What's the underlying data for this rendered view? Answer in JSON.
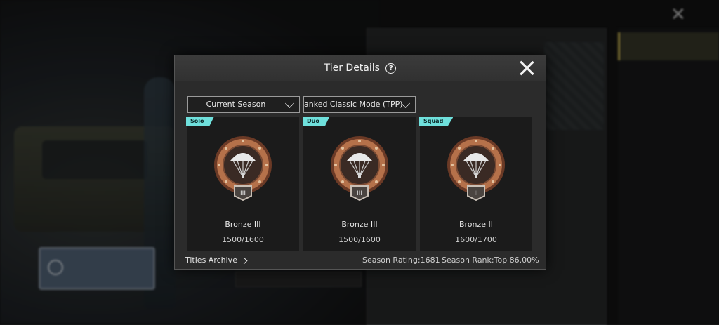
{
  "modal": {
    "title": "Tier Details",
    "help_icon": "question-circle-icon",
    "close_icon": "close-icon"
  },
  "filters": {
    "season": "Current Season",
    "mode": "anked Classic Mode (TPP)"
  },
  "cards": [
    {
      "tag": "Solo",
      "tier": "Bronze III",
      "badge_numeral": "III",
      "points": "1500/1600"
    },
    {
      "tag": "Duo",
      "tier": "Bronze III",
      "badge_numeral": "III",
      "points": "1500/1600"
    },
    {
      "tag": "Squad",
      "tier": "Bronze II",
      "badge_numeral": "II",
      "points": "1600/1700"
    }
  ],
  "footer": {
    "titles_archive": "Titles Archive",
    "season_rating": "Season Rating:1681",
    "season_rank": "Season Rank:Top 86.00%"
  },
  "colors": {
    "tag_bg": "#6fe0dc",
    "bronze": "#b5714a",
    "modal_bg": "#2b2b2b"
  }
}
